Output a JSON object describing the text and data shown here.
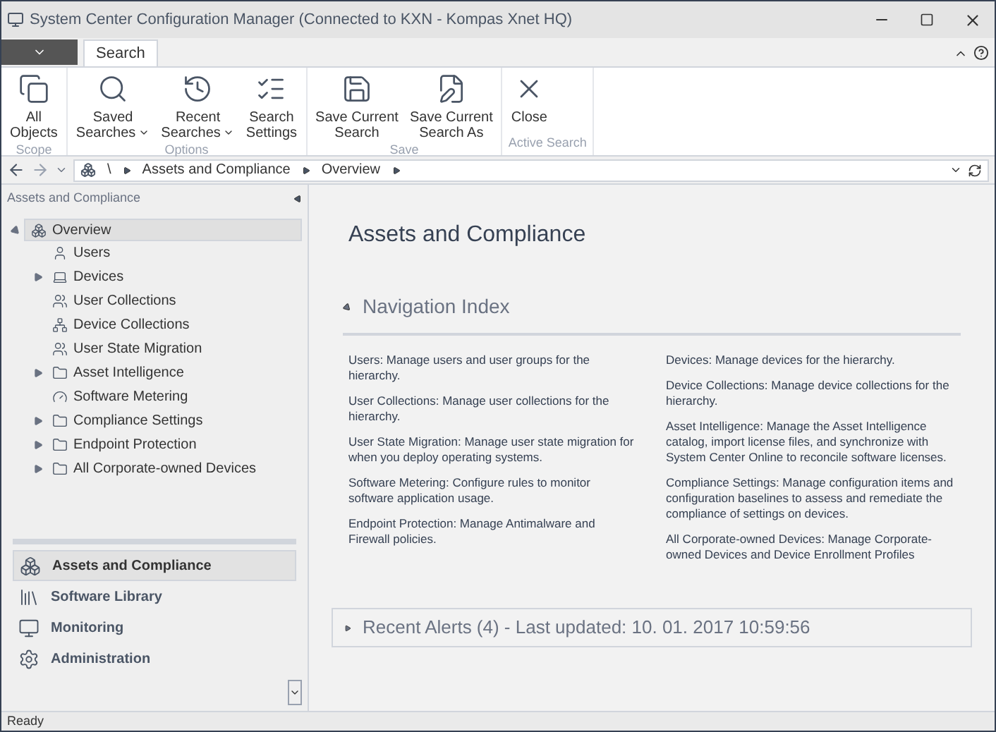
{
  "window": {
    "title": "System Center Configuration Manager (Connected to KXN - Kompas Xnet HQ)"
  },
  "ribbon_tabs": [
    {
      "label": "Search",
      "selected": true
    }
  ],
  "ribbon_groups": [
    {
      "label": "Scope",
      "buttons": [
        {
          "label": "All\nObjects",
          "dropdown": false
        }
      ]
    },
    {
      "label": "Options",
      "buttons": [
        {
          "label": "Saved\nSearches",
          "dropdown": true
        },
        {
          "label": "Recent\nSearches",
          "dropdown": true
        },
        {
          "label": "Search\nSettings",
          "dropdown": false
        }
      ]
    },
    {
      "label": "Save",
      "buttons": [
        {
          "label": "Save Current\nSearch",
          "dropdown": false
        },
        {
          "label": "Save Current\nSearch As",
          "dropdown": false
        }
      ]
    },
    {
      "label": "Active Search",
      "buttons": [
        {
          "label": "Close",
          "dropdown": false
        }
      ]
    }
  ],
  "breadcrumb": {
    "root": "\\",
    "items": [
      "Assets and Compliance",
      "Overview"
    ]
  },
  "left_pane": {
    "title": "Assets and Compliance",
    "tree": [
      {
        "label": "Overview",
        "selected": true,
        "expanded": true,
        "children": [
          {
            "label": "Users"
          },
          {
            "label": "Devices",
            "expanded": false
          },
          {
            "label": "User Collections"
          },
          {
            "label": "Device Collections"
          },
          {
            "label": "User State Migration"
          },
          {
            "label": "Asset Intelligence",
            "expanded": false
          },
          {
            "label": "Software Metering"
          },
          {
            "label": "Compliance Settings",
            "expanded": false
          },
          {
            "label": "Endpoint Protection",
            "expanded": false
          },
          {
            "label": "All Corporate-owned Devices",
            "expanded": false
          }
        ]
      }
    ],
    "workspaces": [
      {
        "label": "Assets and Compliance",
        "selected": true
      },
      {
        "label": "Software Library",
        "selected": false
      },
      {
        "label": "Monitoring",
        "selected": false
      },
      {
        "label": "Administration",
        "selected": false
      }
    ]
  },
  "content": {
    "title": "Assets and Compliance",
    "section": "Navigation Index",
    "columns": [
      [
        "Users: Manage users and user groups for the hierarchy.",
        "User Collections: Manage user collections for the hierarchy.",
        "User State Migration: Manage user state migration for when you deploy operating systems.",
        "Software Metering: Configure rules to monitor software application usage.",
        "Endpoint Protection: Manage Antimalware and Firewall policies."
      ],
      [
        "Devices: Manage devices for the hierarchy.",
        "Device Collections: Manage device collections for the hierarchy.",
        "Asset Intelligence: Manage the Asset Intelligence catalog, import license files, and synchronize with System Center Online to reconcile software licenses.",
        "Compliance Settings: Manage configuration items and configuration baselines to assess and remediate the compliance of settings on devices.",
        "All Corporate-owned Devices: Manage Corporate-owned Devices and Device Enrollment Profiles"
      ]
    ],
    "alerts": "Recent Alerts (4) - Last updated: 10. 01. 2017 10:59:56"
  },
  "status_bar": "Ready"
}
